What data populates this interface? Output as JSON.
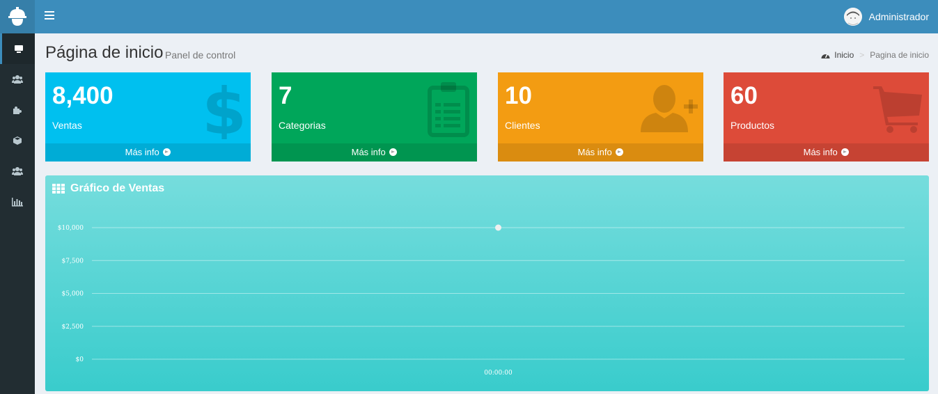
{
  "topbar": {
    "user_name": "Administrador"
  },
  "header": {
    "title": "Página de inicio",
    "subtitle": "Panel de control",
    "breadcrumb": {
      "home": "Inicio",
      "current": "Pagina de inicio"
    }
  },
  "sidebar": {
    "items": [
      {
        "icon": "dashboard-icon",
        "active": true
      },
      {
        "icon": "users-icon"
      },
      {
        "icon": "puzzle-icon"
      },
      {
        "icon": "cube-icon"
      },
      {
        "icon": "users-icon"
      },
      {
        "icon": "bar-chart-icon"
      }
    ]
  },
  "boxes": [
    {
      "value": "8,400",
      "label": "Ventas",
      "more": "Más info",
      "color": "#00c0ef",
      "icon": "dollar-icon"
    },
    {
      "value": "7",
      "label": "Categorias",
      "more": "Más info",
      "color": "#00a65a",
      "icon": "clipboard-icon"
    },
    {
      "value": "10",
      "label": "Clientes",
      "more": "Más info",
      "color": "#f39c12",
      "icon": "user-plus-icon"
    },
    {
      "value": "60",
      "label": "Productos",
      "more": "Más info",
      "color": "#dd4b39",
      "icon": "cart-icon"
    }
  ],
  "chart": {
    "title": "Gráfico de Ventas"
  },
  "chart_data": {
    "type": "line",
    "x": [
      "00:00:00"
    ],
    "series": [
      {
        "values": [
          10000
        ]
      }
    ],
    "ylim": [
      0,
      10000
    ],
    "yticks": [
      "$0",
      "$2,500",
      "$5,000",
      "$7,500",
      "$10,000"
    ],
    "grid": true
  }
}
